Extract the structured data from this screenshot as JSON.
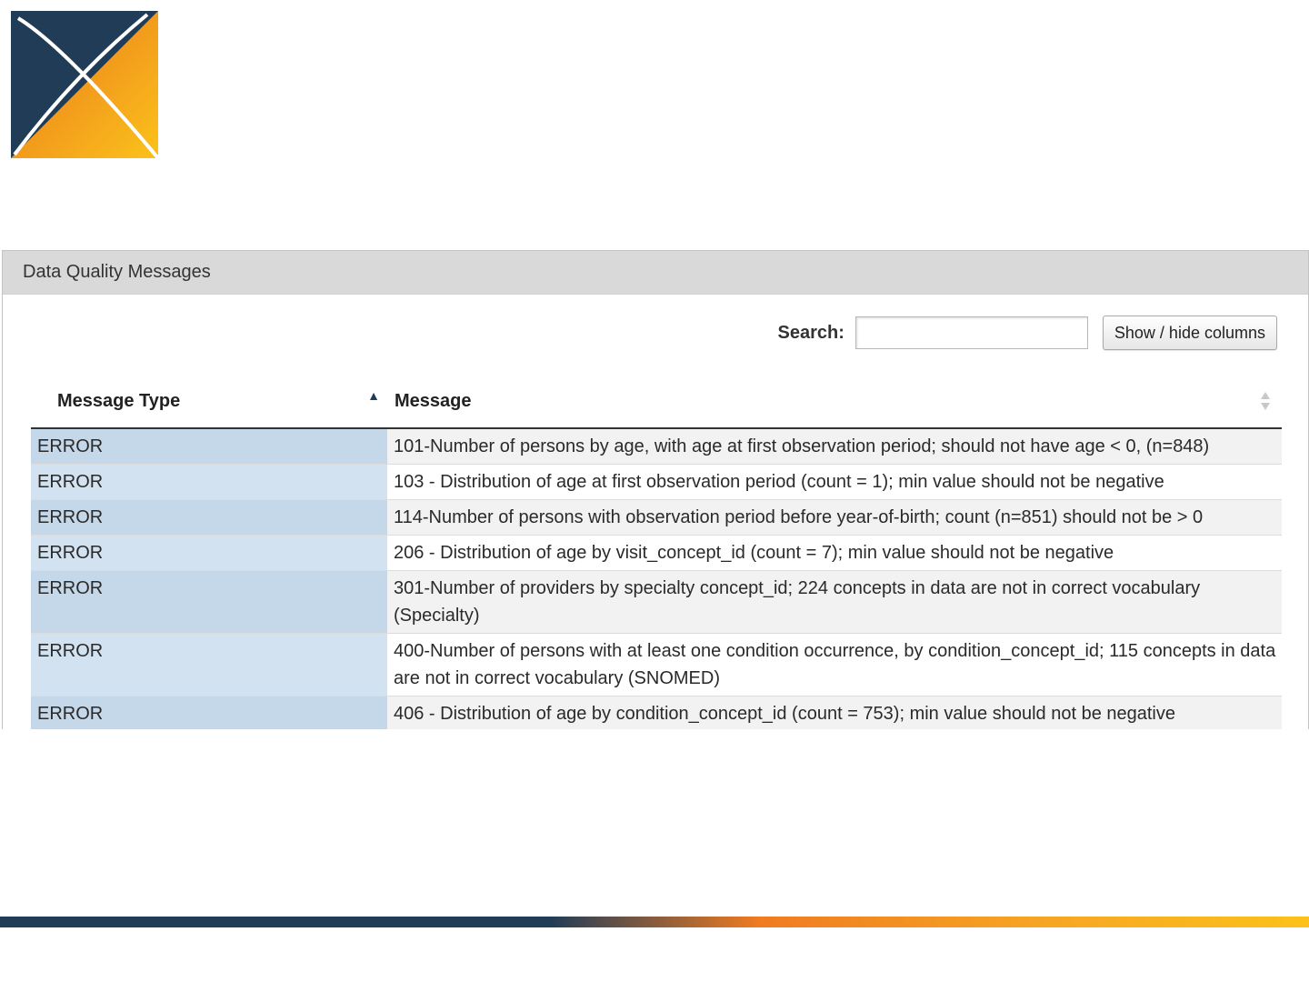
{
  "colors": {
    "navy": "#203c57",
    "orange": "#f07b22",
    "yellow": "#fbc21a",
    "type_cell_blue": "#c4d8ea",
    "panel_header_gray": "#d9d9d9"
  },
  "logo": {
    "icon": "x-diamond-logo"
  },
  "panel": {
    "title": "Data Quality Messages"
  },
  "toolbar": {
    "search_label": "Search:",
    "search_value": "",
    "columns_button_label": "Show / hide columns"
  },
  "table": {
    "columns": [
      {
        "label": "Message Type",
        "sort": "ascending"
      },
      {
        "label": "Message",
        "sort": "none"
      }
    ],
    "rows": [
      {
        "type": "ERROR",
        "message": "101-Number of persons by age, with age at first observation period; should not have age < 0, (n=848)"
      },
      {
        "type": "ERROR",
        "message": "103 - Distribution of age at first observation period (count = 1); min value should not be negative"
      },
      {
        "type": "ERROR",
        "message": "114-Number of persons with observation period before year-of-birth; count (n=851) should not be > 0"
      },
      {
        "type": "ERROR",
        "message": "206 - Distribution of age by visit_concept_id (count = 7); min value should not be negative"
      },
      {
        "type": "ERROR",
        "message": "301-Number of providers by specialty concept_id; 224 concepts in data are not in correct vocabulary (Specialty)"
      },
      {
        "type": "ERROR",
        "message": "400-Number of persons with at least one condition occurrence, by condition_concept_id; 115 concepts in data are not in correct vocabulary (SNOMED)"
      },
      {
        "type": "ERROR",
        "message": "406 - Distribution of age by condition_concept_id (count = 753); min value should not be negative"
      }
    ]
  }
}
